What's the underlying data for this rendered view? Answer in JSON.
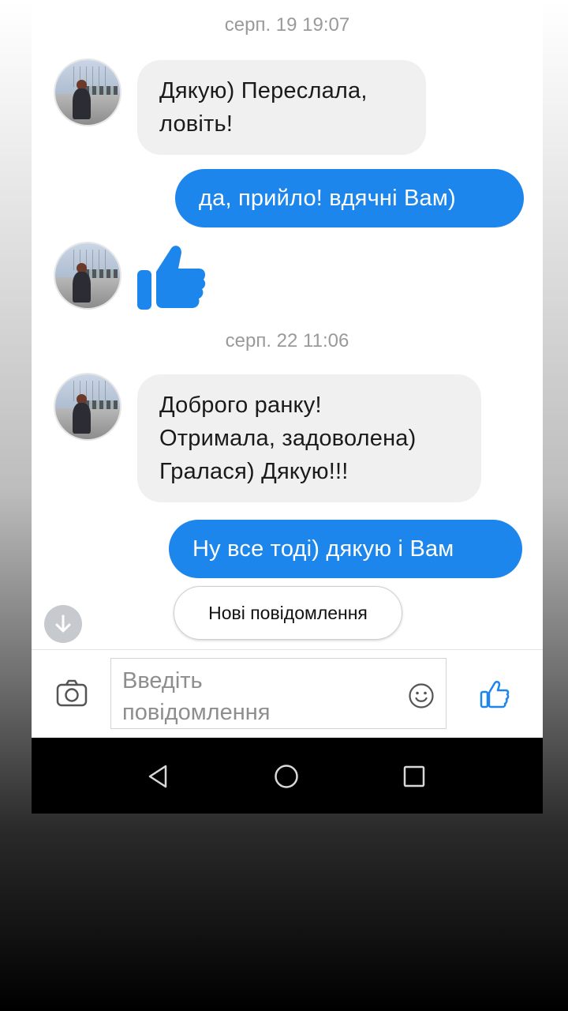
{
  "conversation": {
    "timestamp_1": "серп. 19 19:07",
    "timestamp_2": "серп. 22 11:06",
    "messages": [
      {
        "from": "contact",
        "lines": [
          "Дякую) Переслала,",
          "ловіть!"
        ]
      },
      {
        "from": "me",
        "text": "да, прийло! вдячні Вам)"
      },
      {
        "from": "contact",
        "sticker": "like-thumbs-up-icon"
      },
      {
        "from": "contact",
        "lines": [
          "Доброго ранку!",
          "Отримала, задоволена)",
          "Гралася) Дякую!!!"
        ]
      },
      {
        "from": "me",
        "text": "Ну все тоді) дякую і Вам"
      }
    ],
    "new_messages_label": "Нові повідомлення"
  },
  "composer": {
    "placeholder_lines": [
      "Введіть",
      "повідомлення"
    ],
    "icons": [
      "camera-icon",
      "emoji-icon",
      "like-icon"
    ]
  },
  "navbar": {
    "icons": [
      "back-icon",
      "home-icon",
      "recents-icon"
    ]
  },
  "colors": {
    "outgoing_bubble": "#1d86ec",
    "incoming_bubble": "#f1f0f0",
    "accent": "#1d86ec",
    "timestamp": "#9a9a9a"
  }
}
